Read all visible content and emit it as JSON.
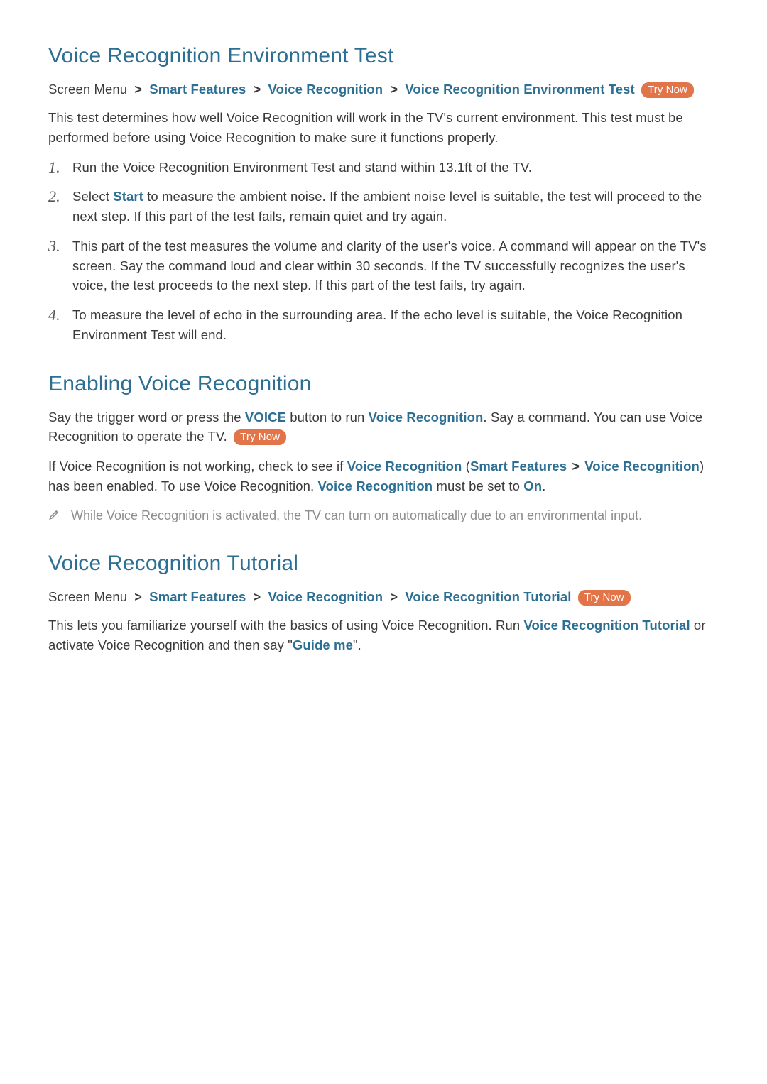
{
  "labels": {
    "try_now": "Try Now",
    "screen_menu": "Screen Menu",
    "chevron": ">"
  },
  "section1": {
    "title": "Voice Recognition Environment Test",
    "path": [
      "Smart Features",
      "Voice Recognition",
      "Voice Recognition Environment Test"
    ],
    "intro": "This test determines how well Voice Recognition will work in the TV's current environment. This test must be performed before using Voice Recognition to make sure it functions properly.",
    "steps": [
      {
        "n": "1.",
        "pre": "Run the Voice Recognition Environment Test and stand within 13.1ft of the TV."
      },
      {
        "n": "2.",
        "pre": "Select ",
        "hl": "Start",
        "post": " to measure the ambient noise. If the ambient noise level is suitable, the test will proceed to the next step. If this part of the test fails, remain quiet and try again."
      },
      {
        "n": "3.",
        "pre": "This part of the test measures the volume and clarity of the user's voice. A command will appear on the TV's screen. Say the command loud and clear within 30 seconds. If the TV successfully recognizes the user's voice, the test proceeds to the next step. If this part of the test fails, try again."
      },
      {
        "n": "4.",
        "pre": "To measure the level of echo in the surrounding area. If the echo level is suitable, the Voice Recognition Environment Test will end."
      }
    ]
  },
  "section2": {
    "title": "Enabling Voice Recognition",
    "para1": {
      "a": "Say the trigger word or press the ",
      "voice": "VOICE",
      "b": " button to run ",
      "vr": "Voice Recognition",
      "c": ". Say a command. You can use Voice Recognition to operate the TV. "
    },
    "para2": {
      "a": "If Voice Recognition is not working, check to see if ",
      "vr1": "Voice Recognition",
      "b": " (",
      "sf": "Smart Features",
      "c": " ",
      "chev": ">",
      "d": " ",
      "vr2": "Voice Recognition",
      "e": ") has been enabled. To use Voice Recognition, ",
      "vr3": "Voice Recognition",
      "f": " must be set to ",
      "on": "On",
      "g": "."
    },
    "note": "While Voice Recognition is activated, the TV can turn on automatically due to an environmental input."
  },
  "section3": {
    "title": "Voice Recognition Tutorial",
    "path": [
      "Smart Features",
      "Voice Recognition",
      "Voice Recognition Tutorial"
    ],
    "para": {
      "a": "This lets you familiarize yourself with the basics of using Voice Recognition. Run ",
      "vrt": "Voice Recognition Tutorial",
      "b": " or activate Voice Recognition and then say \"",
      "guide": "Guide me",
      "c": "\"."
    }
  }
}
